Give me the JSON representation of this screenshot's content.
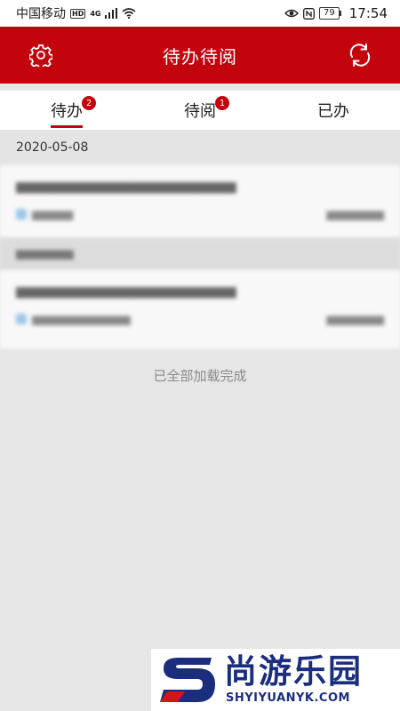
{
  "status_bar": {
    "carrier": "中国移动",
    "hd": "HD",
    "network": "4G",
    "battery": "79",
    "time": "17:54"
  },
  "header": {
    "title": "待办待阅",
    "left_icon": "gear-icon",
    "right_icon": "refresh-icon"
  },
  "tabs": [
    {
      "label": "待办",
      "badge": "2",
      "active": true
    },
    {
      "label": "待阅",
      "badge": "1",
      "active": false
    },
    {
      "label": "已办",
      "badge": "",
      "active": false
    }
  ],
  "list": {
    "date": "2020-05-08",
    "footer": "已全部加载完成"
  },
  "watermark": {
    "name": "尚游乐园",
    "url": "SHYIYUANYK.COM"
  },
  "colors": {
    "accent": "#c4040d",
    "watermark": "#1b2e7e"
  }
}
